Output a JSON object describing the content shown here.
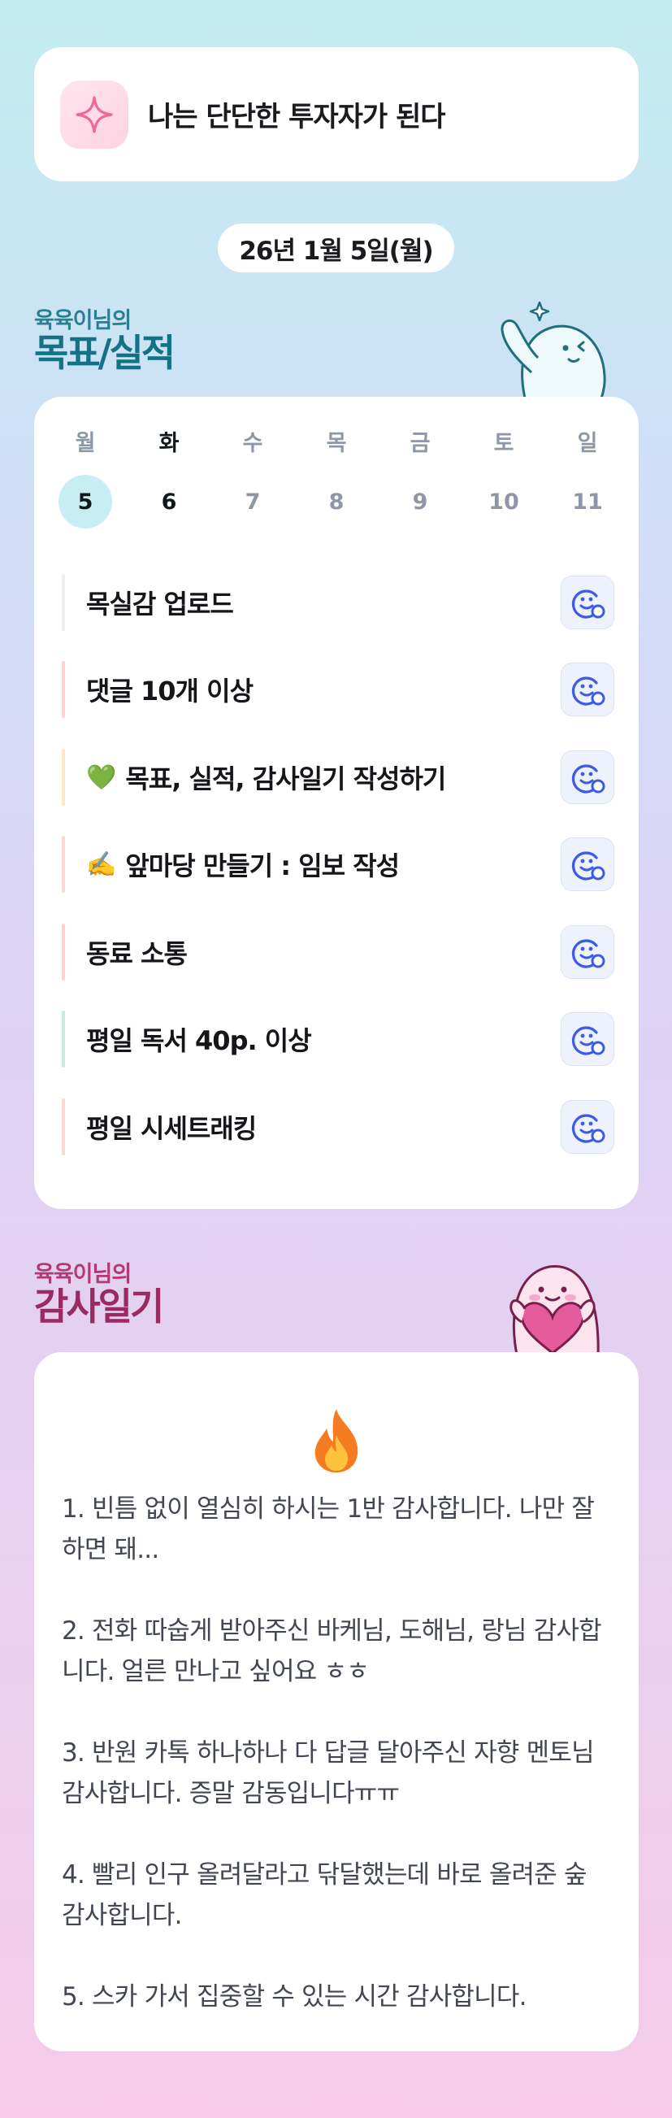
{
  "motto": {
    "icon": "sparkle-icon",
    "text": "나는 단단한 투자자가 된다"
  },
  "date_label": "26년 1월 5일(월)",
  "goals": {
    "heading_small": "육육이님의",
    "heading_big": "목표/실적",
    "week": [
      {
        "name": "월",
        "num": "5"
      },
      {
        "name": "화",
        "num": "6"
      },
      {
        "name": "수",
        "num": "7"
      },
      {
        "name": "목",
        "num": "8"
      },
      {
        "name": "금",
        "num": "9"
      },
      {
        "name": "토",
        "num": "10"
      },
      {
        "name": "일",
        "num": "11"
      }
    ],
    "tasks": [
      {
        "label": "목실감 업로드",
        "emoji": "",
        "bar_color": "#eceef1"
      },
      {
        "label": "댓글 10개 이상",
        "emoji": "",
        "bar_color": "#fbd3d0"
      },
      {
        "label": "목표, 실적, 감사일기 작성하기",
        "emoji": "💚",
        "bar_color": "#fde7c8"
      },
      {
        "label": "앞마당 만들기 : 임보 작성",
        "emoji": "✍️",
        "bar_color": "#fbd8d5"
      },
      {
        "label": "동료 소통",
        "emoji": "",
        "bar_color": "#fbd3d0"
      },
      {
        "label": "평일 독서 40p. 이상",
        "emoji": "",
        "bar_color": "#c8ecdc"
      },
      {
        "label": "평일 시세트래킹",
        "emoji": "",
        "bar_color": "#fbd8d5"
      }
    ],
    "action_icon": "smiley-add-icon"
  },
  "gratitude": {
    "heading_small": "육육이님의",
    "heading_big": "감사일기",
    "icon": "fire-icon",
    "text": "1. 빈틈 없이 열심히 하시는 1반 감사합니다. 나만 잘하면 돼...\n\n2. 전화 따숩게 받아주신 바케님, 도해님, 랑님 감사합니다. 얼른 만나고 싶어요 ㅎㅎ\n\n3. 반원 카톡 하나하나 다 답글 달아주신 자향 멘토님 감사합니다. 증말 감동입니다ㅠㅠ\n\n4. 빨리 인구 올려달라고 닦달했는데 바로 올려준 숲 감사합니다.\n\n5. 스카 가서 집중할 수 있는 시간 감사합니다."
  },
  "colors": {
    "accent_teal": "#137384",
    "accent_pink": "#9a2a62",
    "selected_day_bg": "#c7eef3",
    "action_blue": "#3b5be8"
  }
}
